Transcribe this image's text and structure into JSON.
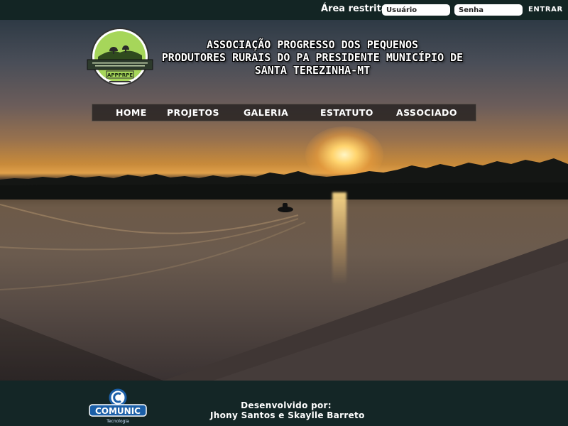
{
  "topbar": {
    "restricted_label": "Área restrita",
    "user_placeholder": "Usuário",
    "password_placeholder": "Senha",
    "enter_label": "ENTRAR"
  },
  "header": {
    "title_lines": [
      "ASSOCIAÇÃO PROGRESSO DOS PEQUENOS",
      "PRODUTORES RURAIS DO PA PRESIDENTE MUNICÍPIO DE",
      "SANTA TEREZINHA-MT"
    ],
    "logo_text": "APPPRPE"
  },
  "nav": {
    "items": [
      {
        "label": "HOME"
      },
      {
        "label": "PROJETOS"
      },
      {
        "label": "GALERIA"
      },
      {
        "label": "ESTATUTO"
      },
      {
        "label": "ASSOCIADO"
      }
    ]
  },
  "footer": {
    "developed_by": "Desenvolvido por:",
    "developers": "Jhony Santos e Skaylle Barreto",
    "brand_name": "COMUNIC",
    "brand_tagline": "Tecnologia"
  },
  "colors": {
    "topbar_bg": "#132524",
    "footer_bg": "#142626",
    "nav_bg": "#2a2624",
    "logo_green": "#a6d65a"
  }
}
